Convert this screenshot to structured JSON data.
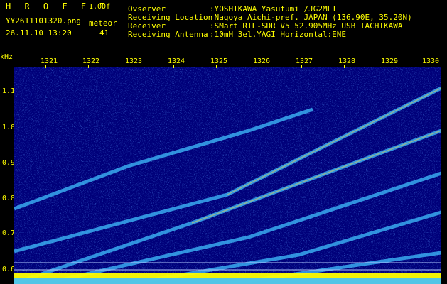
{
  "header": {
    "brand": "H R O F F T",
    "version": "1.00f",
    "filename": "YY2611101320.png",
    "meteor_label": "meteor",
    "datetime": "26.11.10 13:20",
    "meteor_count": "41",
    "observer_label": "Ovserver",
    "observer_value": ":YOSHIKAWA Yasufumi /JG2MLI",
    "location_label": "Receiving Location",
    "location_value": ":Nagoya Aichi-pref. JAPAN (136.90E, 35.20N)",
    "receiver_label": "Receiver",
    "receiver_value": ":SMart RTL-SDR V5 52.905MHz USB TACHIKAWA",
    "antenna_label": "Receiving Antenna",
    "antenna_value": ":10mH 3el.YAGI Horizontal:ENE"
  },
  "axis": {
    "y_unit": "kHz",
    "y_ticks": [
      "1.1",
      "1.0",
      "0.9",
      "0.8",
      "0.7",
      "0.6"
    ],
    "x_ticks": [
      "1321",
      "1322",
      "1323",
      "1324",
      "1325",
      "1326",
      "1327",
      "1328",
      "1329",
      "1330"
    ]
  },
  "colors": {
    "text": "#ffff00",
    "background": "#00007a",
    "trace": "#40c0ff"
  }
}
